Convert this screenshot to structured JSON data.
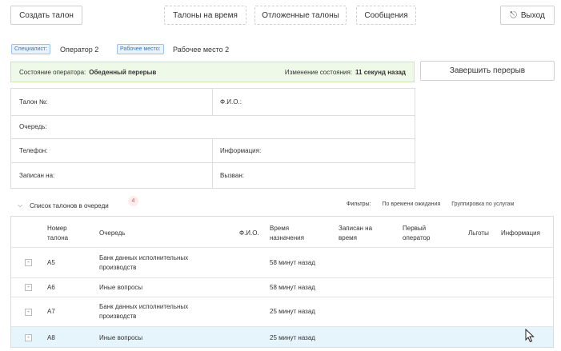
{
  "toolbar": {
    "create_ticket": "Создать талон",
    "timed_tickets": "Талоны на время",
    "postponed_tickets": "Отложенные талоны",
    "messages": "Сообщения",
    "exit": "Выход"
  },
  "operator": {
    "specialist_label": "Специалист:",
    "specialist_value": "Оператор 2",
    "workplace_label": "Рабочее место:",
    "workplace_value": "Рабочее место 2"
  },
  "status": {
    "state_label": "Состояние оператора:",
    "state_value": "Обеденный перерыв",
    "change_label": "Изменение состояния:",
    "change_value": "11 секунд назад",
    "end_break": "Завершить перерыв"
  },
  "info": {
    "ticket_no": "Талон №:",
    "fio": "Ф.И.О.:",
    "queue": "Очередь:",
    "phone": "Телефон:",
    "information": "Информация:",
    "recorded_to": "Записан на:",
    "called": "Вызван:"
  },
  "queue_list": {
    "title": "Список талонов в очереди",
    "count": "4",
    "filters_label": "Фильтры:",
    "filter_wait": "По времени ожидания",
    "filter_group": "Группировка по услугам",
    "columns": {
      "ticket_no_1": "Номер",
      "ticket_no_2": "талона",
      "queue": "Очередь",
      "fio": "Ф.И.О.",
      "time_1": "Время",
      "time_2": "назначения",
      "recorded_1": "Записан на",
      "recorded_2": "время",
      "first_op_1": "Первый",
      "first_op_2": "оператор",
      "benefits": "Льготы",
      "information": "Информация"
    },
    "rows": [
      {
        "ticket": "А5",
        "queue_1": "Банк данных исполнительных",
        "queue_2": "производств",
        "time": "58 минут назад"
      },
      {
        "ticket": "А6",
        "queue_1": "Иные вопросы",
        "queue_2": "",
        "time": "58 минут назад"
      },
      {
        "ticket": "А7",
        "queue_1": "Банк данных исполнительных",
        "queue_2": "производств",
        "time": "25 минут назад"
      },
      {
        "ticket": "А8",
        "queue_1": "Иные вопросы",
        "queue_2": "",
        "time": "25 минут назад"
      }
    ]
  }
}
